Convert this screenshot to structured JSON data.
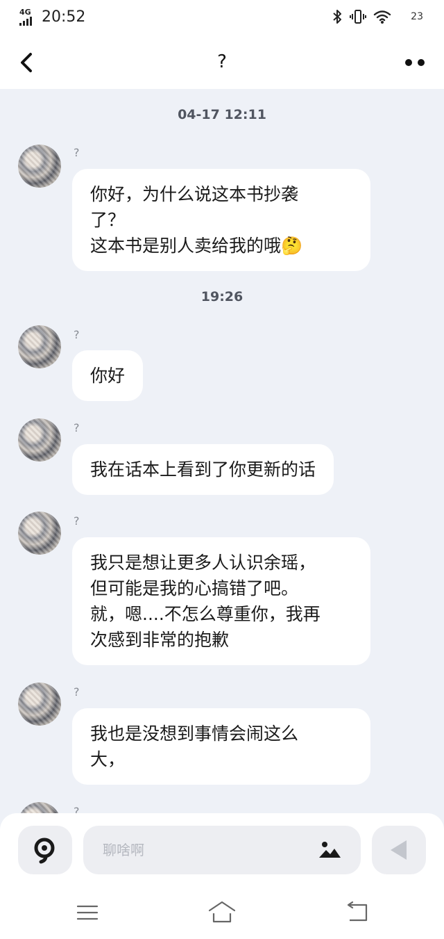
{
  "status_bar": {
    "network": "4G",
    "time": "20:52",
    "battery": "23",
    "icons": [
      "bluetooth-icon",
      "vibrate-icon",
      "wifi-icon"
    ]
  },
  "header": {
    "title": "?",
    "back_icon": "chevron-left-icon",
    "more_icon": "more-dots-icon"
  },
  "chat": {
    "timestamps": [
      "04-17 12:11",
      "19:26"
    ],
    "messages": [
      {
        "sender": "?",
        "text": "你好，为什么说这本书抄袭\n了？\n这本书是别人卖给我的哦🤔"
      },
      {
        "sender": "?",
        "text": "你好"
      },
      {
        "sender": "?",
        "text": "我在话本上看到了你更新的话"
      },
      {
        "sender": "?",
        "text": "我只是想让更多人认识余瑶，\n但可能是我的心搞错了吧。\n就，嗯....不怎么尊重你，我再\n次感到非常的抱歉"
      },
      {
        "sender": "?",
        "text": "我也是没想到事情会闹这么\n大，"
      },
      {
        "sender": "?",
        "text": ""
      }
    ]
  },
  "input_bar": {
    "placeholder": "聊啥啊",
    "value": "",
    "voice_icon": "voice-icon",
    "image_icon": "image-icon",
    "send_icon": "send-icon"
  },
  "system_nav": {
    "icons": [
      "menu-icon",
      "home-icon",
      "back-icon"
    ]
  },
  "colors": {
    "chat_background": "#eef1f7",
    "bubble": "#ffffff",
    "bar_background": "#ffffff",
    "button_background": "#edeef2",
    "placeholder": "#b4b7bf"
  }
}
